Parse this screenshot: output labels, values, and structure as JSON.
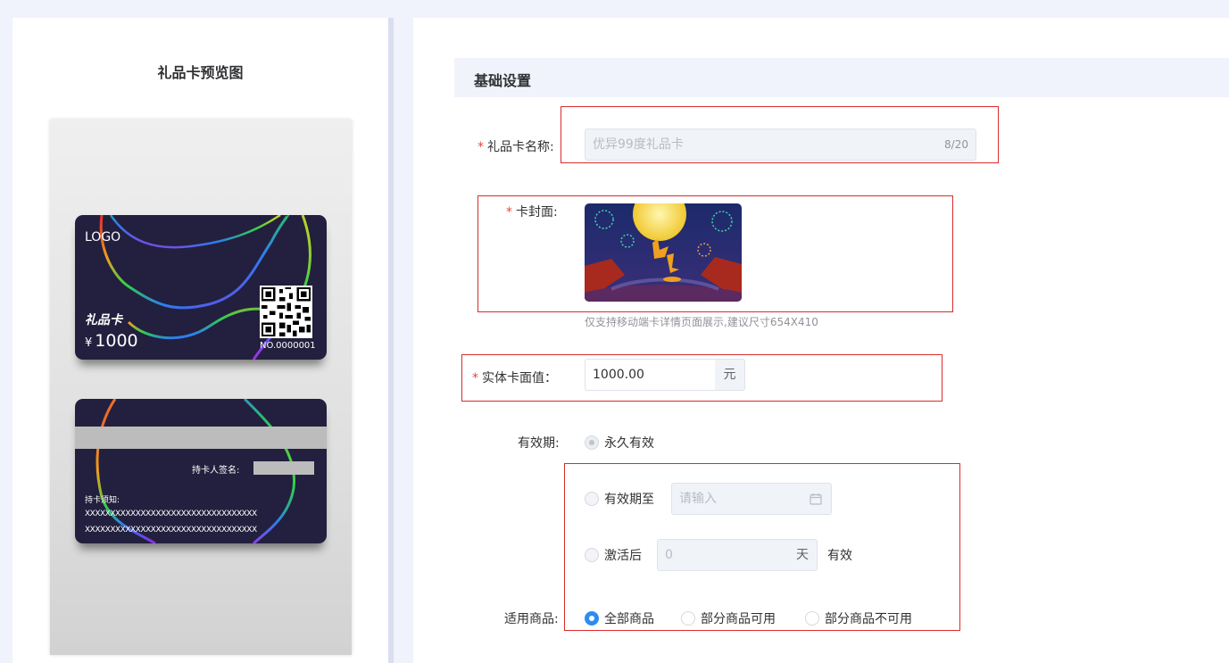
{
  "preview": {
    "title": "礼品卡预览图",
    "front": {
      "logo": "LOGO",
      "brand": "礼品卡",
      "currency": "¥",
      "amount": "1000",
      "card_no": "NO.0000001"
    },
    "back": {
      "sign_label": "持卡人签名:",
      "notice_title": "持卡须知:",
      "notice_lines": [
        "XXXXXXXXXXXXXXXXXXXXXXXXXXXXXXXXXX",
        "XXXXXXXXXXXXXXXXXXXXXXXXXXXXXXXXXX"
      ]
    }
  },
  "form": {
    "section_title": "基础设置",
    "name": {
      "label": "礼品卡名称:",
      "placeholder": "优异99度礼品卡",
      "count": "8/20"
    },
    "cover": {
      "label": "卡封面:",
      "hint": "仅支持移动端卡详情页面展示,建议尺寸654X410"
    },
    "face_value": {
      "label": "实体卡面值：",
      "value": "1000.00",
      "unit": "元"
    },
    "validity": {
      "label": "有效期:",
      "options": {
        "permanent": "永久有效",
        "until": "有效期至",
        "until_placeholder": "请输入",
        "after_activation": "激活后",
        "days_placeholder": "0",
        "days_unit": "天",
        "suffix": "有效"
      }
    },
    "goods": {
      "label": "适用商品:",
      "options": [
        "全部商品",
        "部分商品可用",
        "部分商品不可用"
      ],
      "selected": 0
    }
  },
  "colors": {
    "accent": "#2d8cf0",
    "required": "#e5483a",
    "highlight": "#d92c2c",
    "card_bg": "#22203e"
  }
}
